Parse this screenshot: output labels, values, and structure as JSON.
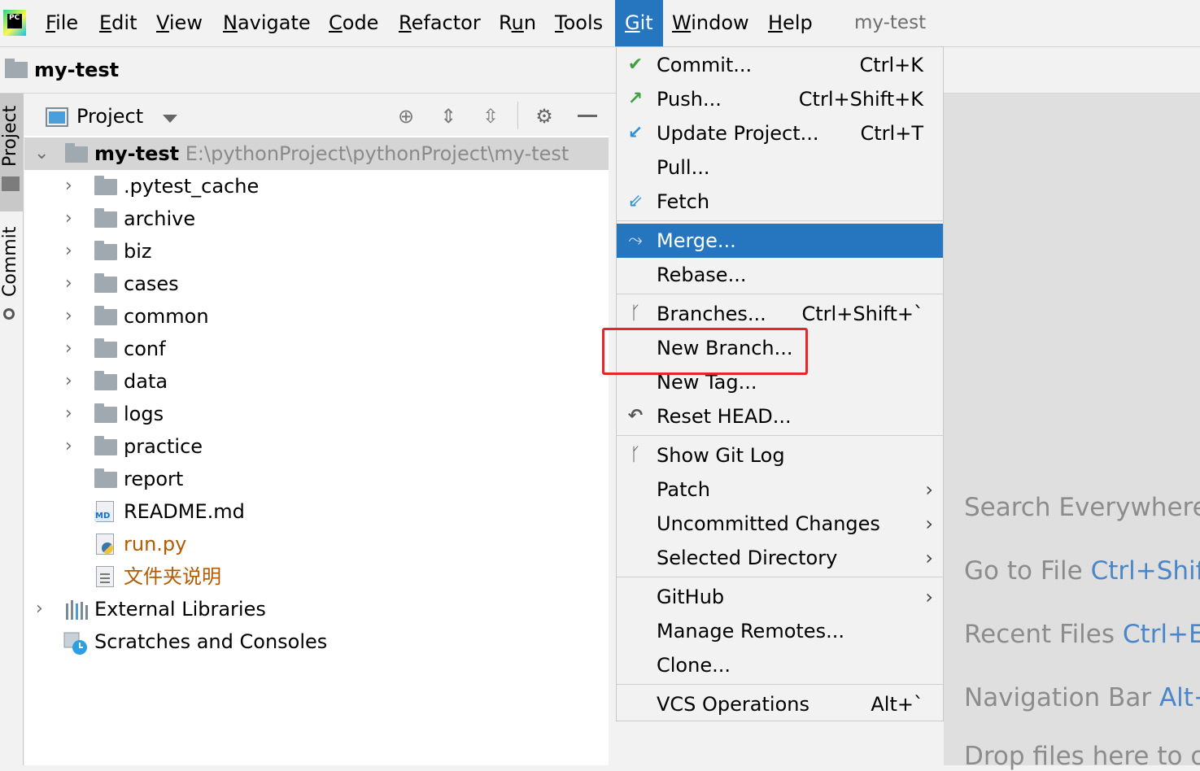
{
  "menubar": {
    "items": [
      {
        "label": "File",
        "u": 0
      },
      {
        "label": "Edit",
        "u": 0
      },
      {
        "label": "View",
        "u": 0
      },
      {
        "label": "Navigate",
        "u": 0
      },
      {
        "label": "Code",
        "u": 0
      },
      {
        "label": "Refactor",
        "u": 0
      },
      {
        "label": "Run",
        "u": 1
      },
      {
        "label": "Tools",
        "u": 0
      },
      {
        "label": "Git",
        "u": 0
      },
      {
        "label": "Window",
        "u": 0
      },
      {
        "label": "Help",
        "u": 0
      }
    ],
    "window_title": "my-test"
  },
  "navbar": {
    "project_name": "my-test"
  },
  "left_strip": {
    "tab_project": "Project",
    "tab_commit": "Commit"
  },
  "project_panel": {
    "title": "Project",
    "root": {
      "name": "my-test",
      "path": "E:\\pythonProject\\pythonProject\\my-test"
    },
    "folders": [
      ".pytest_cache",
      "archive",
      "biz",
      "cases",
      "common",
      "conf",
      "data",
      "logs",
      "practice"
    ],
    "report": "report",
    "readme": "README.md",
    "runpy": "run.py",
    "readme_cn": "文件夹说明",
    "external_libraries": "External Libraries",
    "scratches": "Scratches and Consoles",
    "md_badge": "MD",
    "modified_color": "#b35a00"
  },
  "git_menu": {
    "commit": {
      "label": "Commit...",
      "shortcut": "Ctrl+K"
    },
    "push": {
      "label": "Push...",
      "shortcut": "Ctrl+Shift+K"
    },
    "update": {
      "label": "Update Project...",
      "shortcut": "Ctrl+T"
    },
    "pull": {
      "label": "Pull..."
    },
    "fetch": {
      "label": "Fetch"
    },
    "merge": {
      "label": "Merge..."
    },
    "rebase": {
      "label": "Rebase..."
    },
    "branches": {
      "label": "Branches...",
      "shortcut": "Ctrl+Shift+`"
    },
    "new_branch": {
      "label": "New Branch..."
    },
    "new_tag": {
      "label": "New Tag..."
    },
    "reset_head": {
      "label": "Reset HEAD..."
    },
    "show_git_log": {
      "label": "Show Git Log"
    },
    "patch": {
      "label": "Patch"
    },
    "uncommitted": {
      "label": "Uncommitted Changes"
    },
    "selected_dir": {
      "label": "Selected Directory"
    },
    "github": {
      "label": "GitHub"
    },
    "manage_remotes": {
      "label": "Manage Remotes..."
    },
    "clone": {
      "label": "Clone..."
    },
    "vcs_ops": {
      "label": "VCS Operations",
      "shortcut": "Alt+`"
    },
    "highlight_color": "#2675bf"
  },
  "editor_hints": {
    "search": {
      "text": "Search Everywhere",
      "key": ""
    },
    "goto_file": {
      "text": "Go to File",
      "key": "Ctrl+Shif"
    },
    "recent": {
      "text": "Recent Files",
      "key": "Ctrl+E"
    },
    "navbar": {
      "text": "Navigation Bar",
      "key": "Alt+"
    },
    "drop": {
      "text": "Drop files here to o",
      "key": ""
    }
  }
}
